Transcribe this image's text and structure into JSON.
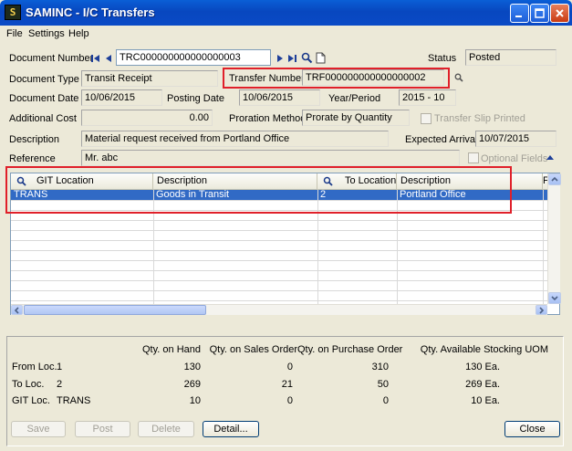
{
  "window": {
    "title": "SAMINC - I/C Transfers",
    "icon_text": "S"
  },
  "menu": [
    "File",
    "Settings",
    "Help"
  ],
  "form": {
    "document_number_label": "Document Number",
    "document_number": "TRC000000000000000003",
    "status_label": "Status",
    "status": "Posted",
    "document_type_label": "Document Type",
    "document_type": "Transit Receipt",
    "transfer_number_label": "Transfer Number",
    "transfer_number": "TRF000000000000000002",
    "document_date_label": "Document Date",
    "document_date": "10/06/2015",
    "posting_date_label": "Posting Date",
    "posting_date": "10/06/2015",
    "year_period_label": "Year/Period",
    "year_period": "2015 - 10",
    "additional_cost_label": "Additional Cost",
    "additional_cost": "0.00",
    "proration_method_label": "Proration Method",
    "proration_method": "Prorate by Quantity",
    "transfer_slip_label": "Transfer Slip Printed",
    "description_label": "Description",
    "description": "Material request received from Portland Office",
    "expected_arrival_label": "Expected Arrival",
    "expected_arrival": "10/07/2015",
    "reference_label": "Reference",
    "reference": "Mr. abc",
    "optional_fields_label": "Optional Fields"
  },
  "grid": {
    "columns": [
      "GIT Location",
      "Description",
      "To Location",
      "Description",
      "F"
    ],
    "rows": [
      {
        "git_location": "TRANS",
        "description": "Goods in Transit",
        "to_location": "2",
        "to_description": "Portland Office"
      }
    ]
  },
  "totals": {
    "headers": [
      "Qty. on Hand",
      "Qty. on Sales Order",
      "Qty. on Purchase Order",
      "Qty. Available Stocking UOM"
    ],
    "rows": [
      {
        "label": "From Loc.",
        "loc": "1",
        "on_hand": "130",
        "sales_order": "0",
        "purchase_order": "310",
        "available": "130 Ea."
      },
      {
        "label": "To Loc.",
        "loc": "2",
        "on_hand": "269",
        "sales_order": "21",
        "purchase_order": "50",
        "available": "269 Ea."
      },
      {
        "label": "GIT Loc.",
        "loc": "TRANS",
        "on_hand": "10",
        "sales_order": "0",
        "purchase_order": "0",
        "available": "10 Ea."
      }
    ]
  },
  "buttons": {
    "save": "Save",
    "post": "Post",
    "delete": "Delete",
    "detail": "Detail...",
    "close": "Close"
  },
  "colors": {
    "highlight_red": "#e0202a",
    "selected_row": "#316ac5",
    "titlebar": "#0a4ac6"
  }
}
